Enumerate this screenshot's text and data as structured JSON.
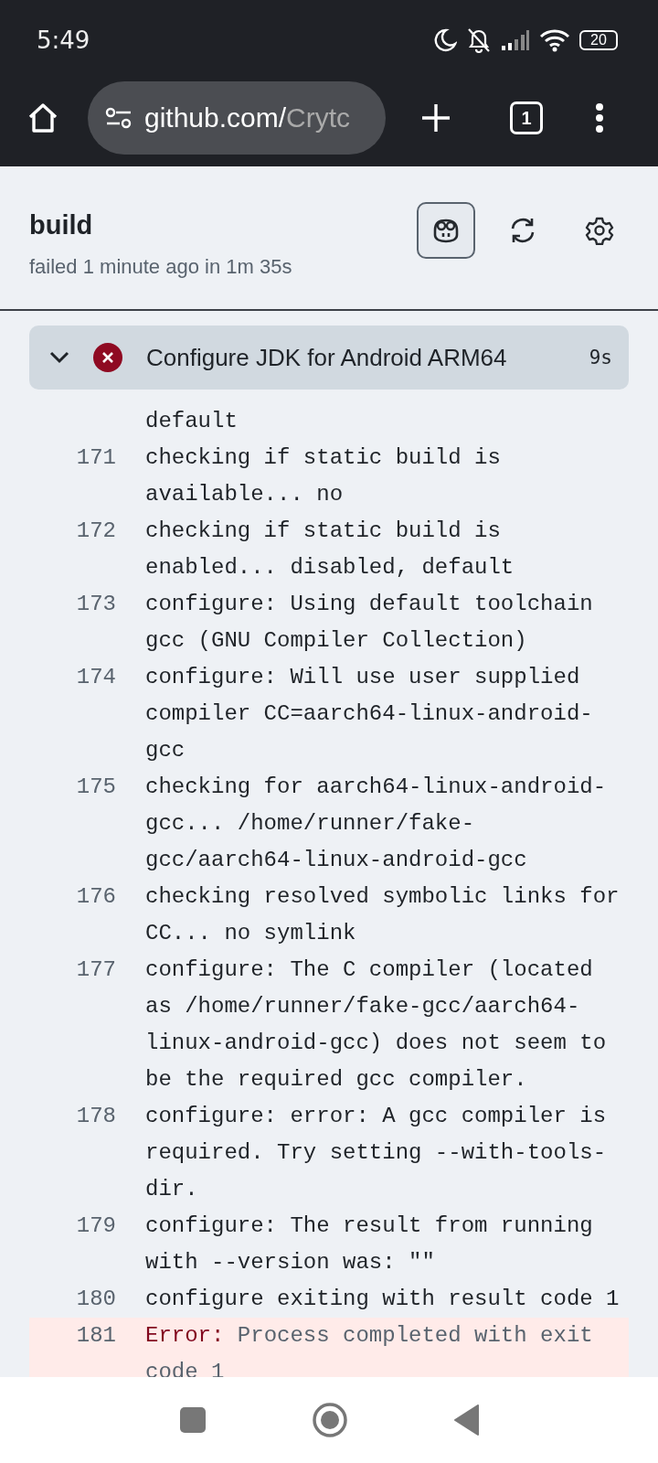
{
  "status_bar": {
    "time": "5:49",
    "battery": "20"
  },
  "browser": {
    "url_host": "github.com/",
    "url_path": "Crytc",
    "tab_count": "1"
  },
  "job": {
    "title": "build",
    "subtitle": "failed 1 minute ago in 1m 35s",
    "copilot_selected": true
  },
  "step": {
    "name": "Configure JDK for Android ARM64",
    "duration": "9s",
    "expanded": true
  },
  "log": [
    {
      "text": "default"
    },
    {
      "number": "171",
      "text": "checking if static build is available... no"
    },
    {
      "number": "172",
      "text": "checking if static build is enabled... disabled, default"
    },
    {
      "number": "173",
      "text": "configure: Using default toolchain gcc (GNU Compiler Collection)"
    },
    {
      "number": "174",
      "text": "configure: Will use user supplied compiler CC=aarch64-linux-android-gcc"
    },
    {
      "number": "175",
      "text": "checking for aarch64-linux-android-gcc... /home/runner/fake-gcc/aarch64-linux-android-gcc"
    },
    {
      "number": "176",
      "text": "checking resolved symbolic links for CC... no symlink"
    },
    {
      "number": "177",
      "text": "configure: The C compiler (located as /home/runner/fake-gcc/aarch64-linux-android-gcc) does not seem to be the required gcc compiler."
    },
    {
      "number": "178",
      "text": "configure: error: A gcc compiler is required. Try setting --with-tools-dir."
    },
    {
      "number": "179",
      "text": "configure: The result from running with --version was: \"\""
    },
    {
      "number": "180",
      "text": "configure exiting with result code 1"
    },
    {
      "number": "181",
      "kind": "error",
      "label": "Error:",
      "text": "Process completed with exit code 1"
    }
  ]
}
